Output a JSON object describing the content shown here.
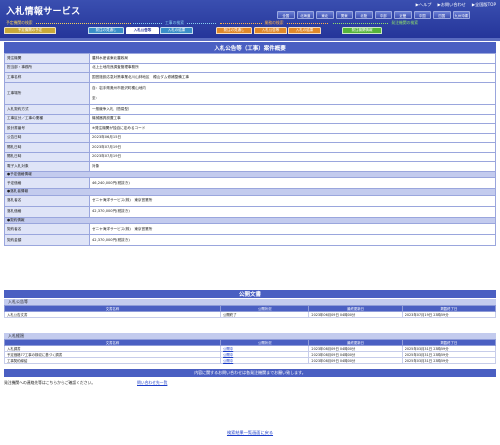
{
  "header": {
    "title": "入札情報サービス",
    "links": [
      "▶ヘルプ",
      "▶お問い合わせ",
      "▶全国版TOP"
    ],
    "regions": [
      "全国",
      "北海道",
      "東北",
      "関東",
      "北陸",
      "中部",
      "近畿",
      "中国",
      "四国",
      "九州沖縄"
    ]
  },
  "categories": [
    {
      "label": "予定機関の検索",
      "color": "#f5d05a"
    },
    {
      "label": "工事の検索",
      "color": "#86d0f0"
    },
    {
      "label": "業務の検索",
      "color": "#ffb24a"
    },
    {
      "label": "発注機関の検索",
      "color": "#8fe06a"
    }
  ],
  "tabs": [
    {
      "label": "予定機関の予定",
      "color": "#c9a93a",
      "active": false
    },
    {
      "label": "発注の見通し",
      "color": "#3a8fc8",
      "active": false
    },
    {
      "label": "入札公告等",
      "color": "#3a8fc8",
      "active": true
    },
    {
      "label": "入札の結果",
      "color": "#3a8fc8",
      "active": false
    },
    {
      "label": "発注の見通し",
      "color": "#e0892a",
      "active": false
    },
    {
      "label": "入札公告等",
      "color": "#e0892a",
      "active": false
    },
    {
      "label": "入札の結果",
      "color": "#e0892a",
      "active": false
    },
    {
      "label": "発注機関情報",
      "color": "#56b43a",
      "active": false
    }
  ],
  "panel_title": "入札公告等（工事）案件概要",
  "rows": [
    {
      "label": "発注機関",
      "value": "農林水産省東北農政局"
    },
    {
      "label": "担当部・事務所",
      "value": "北上土地改良調査管理事務所"
    },
    {
      "label": "工事名称",
      "value": "国営施設応急対策事業北川山林地区　穂山ダム修補整備工事"
    },
    {
      "label": "工事場所",
      "value": "自：岩手県奥州市胆沢町穂山地内",
      "value2": "至："
    },
    {
      "label": "入札契約方式",
      "value": "一般競争入札（簡易型）"
    },
    {
      "label": "工事区分／工事の業種",
      "value": "機械器具設置工事"
    },
    {
      "label": "設計書番号",
      "value": "※発注機関が独自に定めるコード"
    },
    {
      "label": "公告日時",
      "value": "2023年06月15日"
    },
    {
      "label": "開札日時",
      "value": "2023年07月19日"
    },
    {
      "label": "開札日時",
      "value": "2023年07月19日"
    },
    {
      "label": "電子入札対象",
      "value": "対象"
    }
  ],
  "sections": {
    "estimate": {
      "title": "●予定価格情報",
      "rows": [
        {
          "label": "予定価格",
          "value": "46,240,000円(税抜き)"
        }
      ]
    },
    "winner": {
      "title": "●落札者情報",
      "rows": [
        {
          "label": "落札者名",
          "value": "ゼニヤ海洋サービス(株)　東京営業所"
        },
        {
          "label": "落札価格",
          "value": "42,370,000円(税抜き)"
        }
      ]
    },
    "contract": {
      "title": "●契約情報",
      "rows": [
        {
          "label": "契約者名",
          "value": "ゼニヤ海洋サービス(株)　東京営業所"
        },
        {
          "label": "契約金額",
          "value": "42,370,000円(税抜き)"
        }
      ]
    }
  },
  "documents": {
    "title": "公開文書",
    "announcement": {
      "title": "入札公告等",
      "headers": [
        "文書名称",
        "公開状況",
        "最終更新日",
        "掲載終了日"
      ],
      "rows": [
        [
          "入札公告文書",
          "公開終了",
          "2023年06月09日 04時00分",
          "2023年07月19日 23時59分"
        ]
      ]
    },
    "result": {
      "title": "入札経過",
      "headers": [
        "文書名称",
        "公開状況",
        "最終更新日",
        "掲載終了日"
      ],
      "rows": [
        [
          "入札調書",
          "公開中",
          "2023年08月09日 04時00分",
          "2025年03月31日 23時59分"
        ],
        [
          "予定価格77工事の検収に基づく調書",
          "公開中",
          "2023年08月09日 04時00分",
          "2025年03月31日 23時59分"
        ],
        [
          "工事契約締結",
          "公開中",
          "2023年08月09日 04時00分",
          "2025年03月31日 23時59分"
        ]
      ]
    }
  },
  "notice": "内容に関するお問い合わせは各発注機関までお願い致します。",
  "contact": {
    "label": "発注機関への連絡先等はこちらからご確認ください。",
    "link": "問い合わせ先一覧"
  },
  "back_link": "検索結果一覧画面に戻る"
}
